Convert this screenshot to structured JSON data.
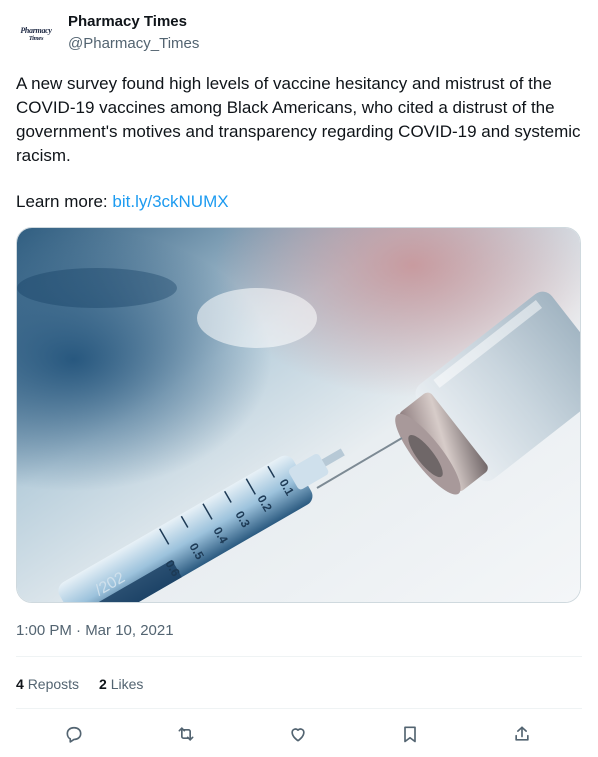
{
  "account": {
    "name": "Pharmacy Times",
    "handle": "@Pharmacy_Times",
    "avatar_line1": "Pharmacy",
    "avatar_line2": "Times"
  },
  "tweet": {
    "text": "A new survey found high levels of vaccine hesitancy and mistrust of the COVID-19 vaccines among Black Americans, who cited a distrust of the government's motives and transparency regarding COVID-19 and systemic racism.",
    "learn_prefix": "Learn more: ",
    "link": "bit.ly/3ckNUMX",
    "timestamp": "1:00 PM · Mar 10, 2021"
  },
  "media": {
    "description_icon": "vaccine-photo",
    "syringe_marks": [
      "0.1",
      "0.2",
      "0.3",
      "0.4",
      "0.5",
      "0.6"
    ],
    "syringe_label": "/202"
  },
  "stats": {
    "reposts_count": "4",
    "reposts_label": "Reposts",
    "likes_count": "2",
    "likes_label": "Likes"
  },
  "actions": [
    {
      "name": "reply",
      "icon": "reply-icon"
    },
    {
      "name": "repost",
      "icon": "repost-icon"
    },
    {
      "name": "like",
      "icon": "heart-icon"
    },
    {
      "name": "bookmark",
      "icon": "bookmark-icon"
    },
    {
      "name": "share",
      "icon": "share-icon"
    }
  ],
  "colors": {
    "link": "#1d9bf0",
    "secondary_text": "#536471",
    "primary_text": "#0f1419",
    "divider": "#eff3f4"
  }
}
